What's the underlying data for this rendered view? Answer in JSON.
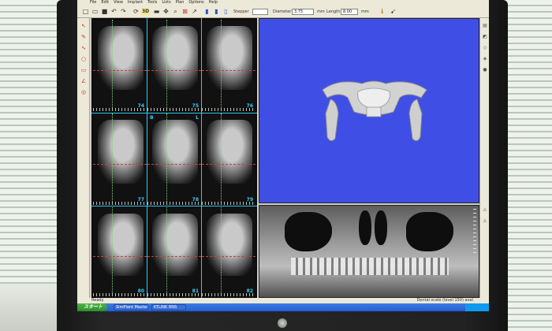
{
  "menu": [
    "File",
    "Edit",
    "View",
    "Implant",
    "Tools",
    "Lists",
    "Plan",
    "Options",
    "Help"
  ],
  "toolbar": {
    "mode_label": "3D",
    "field1_label": "Stepper",
    "field2_label": "Diameter",
    "field2_value": "3.75",
    "unit1": "mm",
    "field3_label": "Length",
    "field3_value": "8.00",
    "unit2": "mm"
  },
  "slices": [
    "74",
    "75",
    "76",
    "77",
    "78",
    "79",
    "80",
    "81",
    "82"
  ],
  "orientation": {
    "b": "B",
    "l": "L"
  },
  "status": {
    "left": "Ready",
    "right": "Dental scale (level 150) aval"
  },
  "taskbar": {
    "start": "スタート",
    "tasks": [
      "SimPlant Master",
      "KTLINK RNS"
    ]
  },
  "colors": {
    "viewport_blue": "#3f4fe6",
    "slice_number": "#3ec8ff",
    "guide_line": "#c84040"
  }
}
